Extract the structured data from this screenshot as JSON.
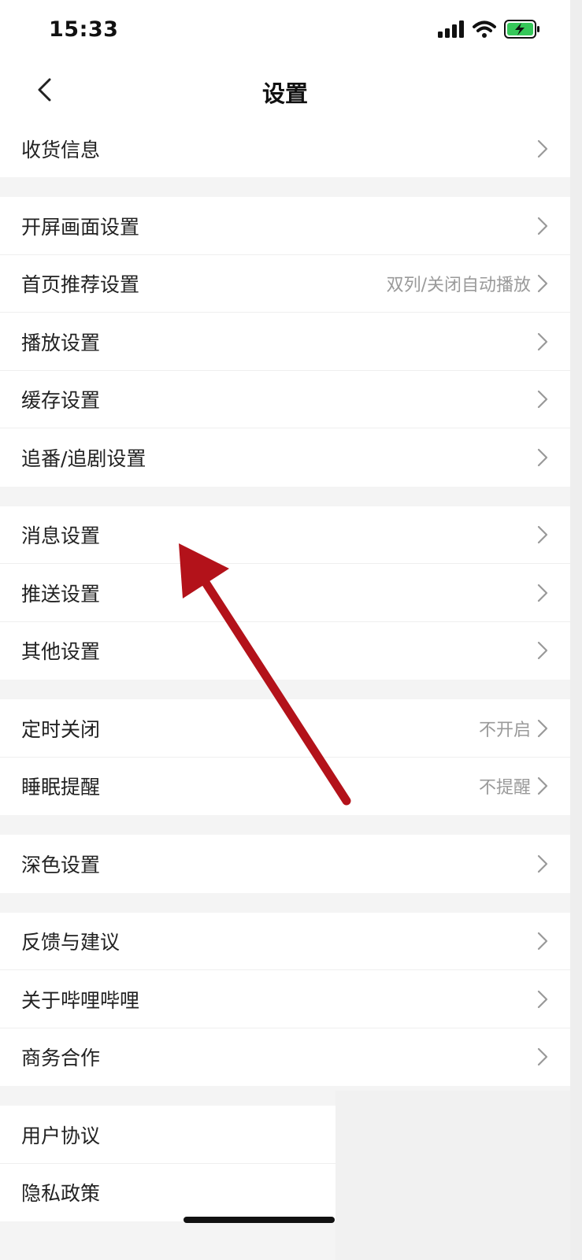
{
  "status_bar": {
    "time": "15:33",
    "icons": [
      "signal-icon",
      "wifi-icon",
      "battery-charging-icon"
    ],
    "battery_color": "#35c759"
  },
  "nav": {
    "title": "设置",
    "back_icon": "chevron-left-icon"
  },
  "groups": [
    {
      "items": [
        {
          "label": "收货信息",
          "value": ""
        }
      ]
    },
    {
      "items": [
        {
          "label": "开屏画面设置",
          "value": ""
        },
        {
          "label": "首页推荐设置",
          "value": "双列/关闭自动播放"
        },
        {
          "label": "播放设置",
          "value": ""
        },
        {
          "label": "缓存设置",
          "value": ""
        },
        {
          "label": "追番/追剧设置",
          "value": ""
        }
      ]
    },
    {
      "items": [
        {
          "label": "消息设置",
          "value": ""
        },
        {
          "label": "推送设置",
          "value": ""
        },
        {
          "label": "其他设置",
          "value": ""
        }
      ]
    },
    {
      "items": [
        {
          "label": "定时关闭",
          "value": "不开启"
        },
        {
          "label": "睡眠提醒",
          "value": "不提醒"
        }
      ]
    },
    {
      "items": [
        {
          "label": "深色设置",
          "value": ""
        }
      ]
    },
    {
      "items": [
        {
          "label": "反馈与建议",
          "value": ""
        },
        {
          "label": "关于哔哩哔哩",
          "value": ""
        },
        {
          "label": "商务合作",
          "value": ""
        }
      ]
    },
    {
      "items": [
        {
          "label": "用户协议",
          "value": ""
        },
        {
          "label": "隐私政策",
          "value": ""
        }
      ]
    }
  ],
  "annotation": {
    "arrow_color": "#b3121a",
    "points_to": "消息设置"
  },
  "colors": {
    "background": "#f4f4f4",
    "row": "#ffffff",
    "secondary_text": "#9a9a9a"
  }
}
